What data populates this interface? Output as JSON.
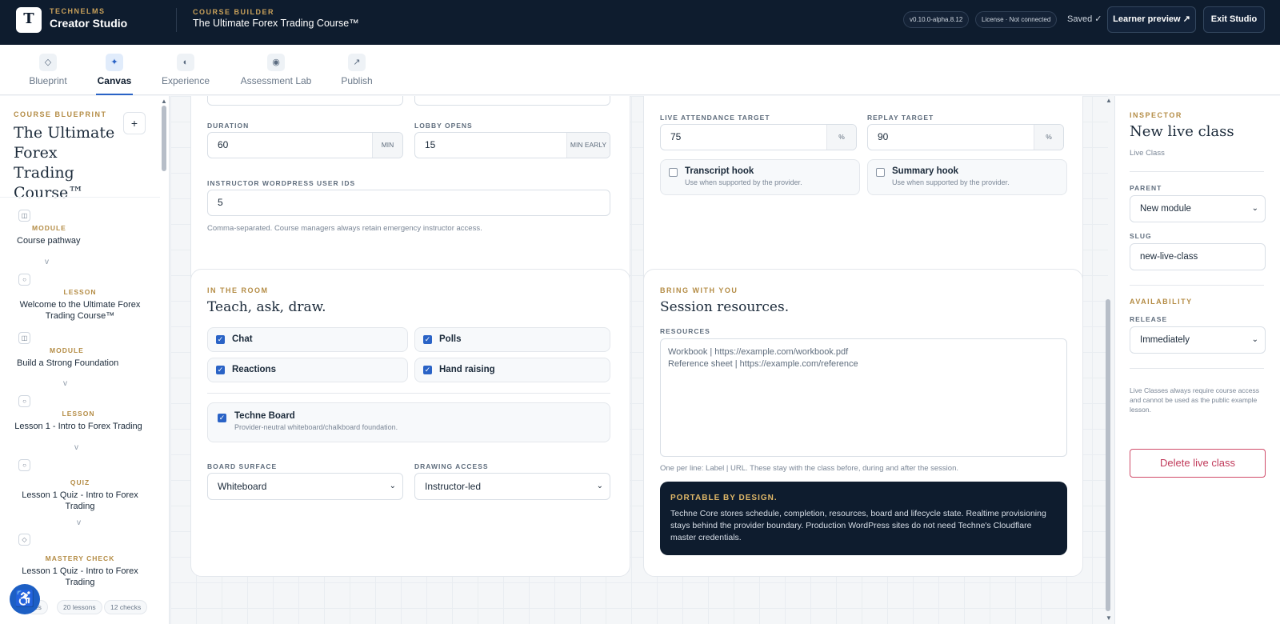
{
  "topbar": {
    "logo_glyph": "T",
    "brand_small": "TECHNELMS",
    "brand_big": "Creator Studio",
    "course_builder_label": "COURSE BUILDER",
    "course_title": "The Ultimate Forex Trading Course™",
    "version": "v0.10.0-alpha.8.12",
    "license": "License · Not connected",
    "saved": "Saved ✓",
    "learner_preview": "Learner preview ↗",
    "exit_studio": "Exit Studio"
  },
  "tabs": [
    {
      "label": "Blueprint",
      "icon": "◇"
    },
    {
      "label": "Canvas",
      "icon": "✦"
    },
    {
      "label": "Experience",
      "icon": "◐"
    },
    {
      "label": "Assessment Lab",
      "icon": "◉"
    },
    {
      "label": "Publish",
      "icon": "↗"
    }
  ],
  "sidebar": {
    "eyebrow": "COURSE BLUEPRINT",
    "title": "The Ultimate Forex Trading Course™",
    "add": "+",
    "items": [
      {
        "kind": "MODULE",
        "name": "Course pathway",
        "icon": "◫"
      },
      {
        "kind": "LESSON",
        "name": "Welcome to the Ultimate Forex Trading Course™",
        "icon": "○"
      },
      {
        "kind": "MODULE",
        "name": "Build a Strong Foundation",
        "icon": "◫"
      },
      {
        "kind": "LESSON",
        "name": "Lesson 1 - Intro to Forex Trading",
        "icon": "○"
      },
      {
        "kind": "QUIZ",
        "name": "Lesson 1 Quiz - Intro to Forex Trading",
        "icon": "○"
      },
      {
        "kind": "MASTERY CHECK",
        "name": "Lesson 1 Quiz - Intro to Forex Trading",
        "icon": "◇"
      }
    ],
    "chevron": "v",
    "stats": [
      "les",
      "20 lessons",
      "12 checks"
    ]
  },
  "schedule_card": {
    "duration_label": "DURATION",
    "duration_value": "60",
    "duration_unit": "MIN",
    "lobby_label": "LOBBY OPENS",
    "lobby_value": "15",
    "lobby_unit": "MIN EARLY",
    "instructor_label": "INSTRUCTOR WORDPRESS USER IDS",
    "instructor_value": "5",
    "instructor_help": "Comma-separated. Course managers always retain emergency instructor access."
  },
  "targets_card": {
    "live_label": "LIVE ATTENDANCE TARGET",
    "live_value": "75",
    "replay_label": "REPLAY TARGET",
    "replay_value": "90",
    "unit": "%",
    "transcript_title": "Transcript hook",
    "transcript_sub": "Use when supported by the provider.",
    "summary_title": "Summary hook",
    "summary_sub": "Use when supported by the provider."
  },
  "room_card": {
    "eyebrow": "IN THE ROOM",
    "heading": "Teach, ask, draw.",
    "chat": "Chat",
    "polls": "Polls",
    "reactions": "Reactions",
    "hand_raising": "Hand raising",
    "board_title": "Techne Board",
    "board_sub": "Provider-neutral whiteboard/chalkboard foundation.",
    "surface_label": "BOARD SURFACE",
    "surface_value": "Whiteboard",
    "access_label": "DRAWING ACCESS",
    "access_value": "Instructor-led",
    "check_glyph": "✓",
    "caret": "⌄"
  },
  "resources_card": {
    "eyebrow": "BRING WITH YOU",
    "heading": "Session resources.",
    "resources_label": "RESOURCES",
    "line1": "Workbook | https://example.com/workbook.pdf",
    "line2": "Reference sheet | https://example.com/reference",
    "help": "One per line: Label | URL. These stay with the class before, during and after the session.",
    "callout_title": "PORTABLE BY DESIGN.",
    "callout_body": "Techne Core stores schedule, completion, resources, board and lifecycle state. Realtime provisioning stays behind the provider boundary. Production WordPress sites do not need Techne's Cloudflare master credentials."
  },
  "inspector": {
    "eyebrow": "INSPECTOR",
    "title": "New live class",
    "subtitle": "Live Class",
    "parent_label": "PARENT",
    "parent_value": "New module",
    "slug_label": "SLUG",
    "slug_value": "new-live-class",
    "availability": "AVAILABILITY",
    "release_label": "RELEASE",
    "release_value": "Immediately",
    "note": "Live Classes always require course access and cannot be used as the public example lesson.",
    "delete": "Delete live class"
  }
}
